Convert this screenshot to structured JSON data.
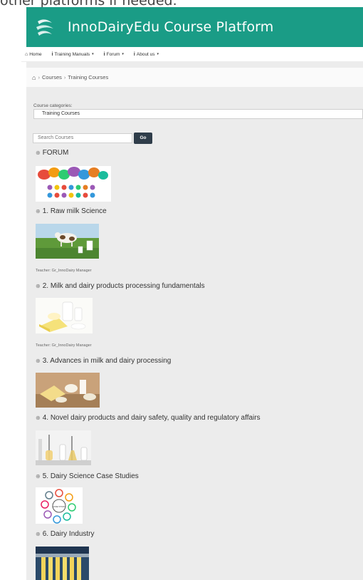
{
  "top_cutoff_text": "other platforms if needed.",
  "header": {
    "logo_icon": "innodairy-logo-icon",
    "title": "InnoDairyEdu Course Platform",
    "bg_color": "#1a9c86"
  },
  "navbar": {
    "items": [
      {
        "label": "Home",
        "icon": "home-icon"
      },
      {
        "label": "Training Manuals",
        "icon": "info-icon",
        "caret": "▾"
      },
      {
        "label": "Forum",
        "icon": "info-icon",
        "caret": "▾"
      },
      {
        "label": "About us",
        "icon": "info-icon",
        "caret": "▾"
      }
    ]
  },
  "breadcrumb": {
    "sep": "›",
    "items": [
      "Courses",
      "Training Courses"
    ]
  },
  "filters": {
    "category_label": "Course categories:",
    "category_selected": "Training Courses",
    "search_placeholder": "Search Courses",
    "go_label": "Go"
  },
  "courses": [
    {
      "title": "FORUM",
      "icon": "course-icon"
    },
    {
      "title": "1. Raw milk Science",
      "icon": "course-icon",
      "teacher": "Teacher: Gr_InnoDairy Manager"
    },
    {
      "title": "2. Milk and dairy products processing fundamentals",
      "icon": "course-icon",
      "teacher": "Teacher: Gr_InnoDairy Manager"
    },
    {
      "title": "3. Advances in milk and dairy processing",
      "icon": "course-icon"
    },
    {
      "title": "4. Novel dairy products and dairy safety, quality and regulatory affairs",
      "icon": "course-icon"
    },
    {
      "title": "5. Dairy Science Case Studies",
      "icon": "course-icon"
    },
    {
      "title": "6. Dairy Industry",
      "icon": "course-icon"
    }
  ],
  "case_study_center_label": "CASE STUDY"
}
